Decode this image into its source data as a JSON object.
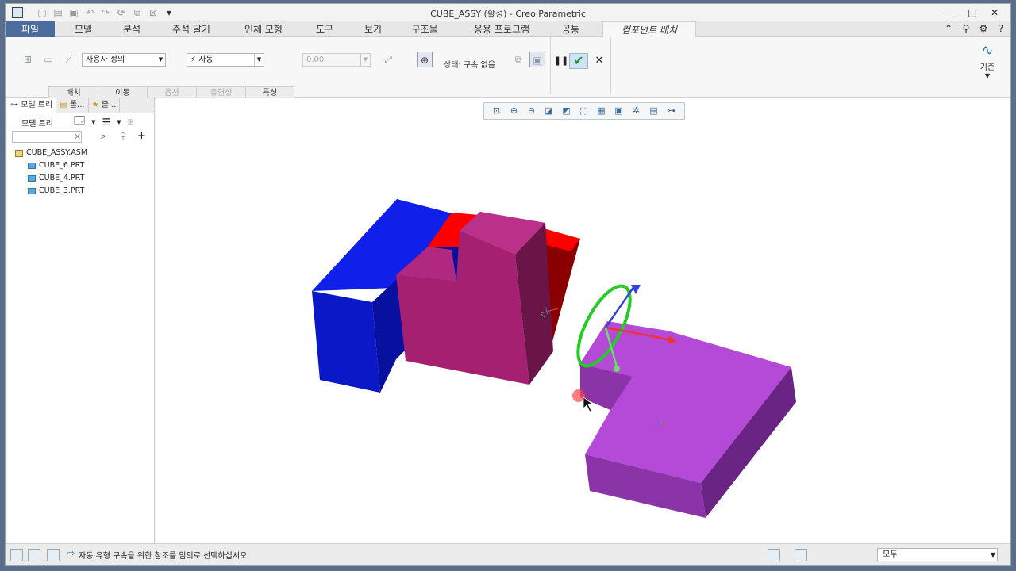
{
  "window": {
    "title": "CUBE_ASSY (활성) - Creo Parametric",
    "controls": [
      "—",
      "□",
      "✕"
    ]
  },
  "ribbon_tabs": [
    {
      "label": "파일"
    },
    {
      "label": "모델"
    },
    {
      "label": "분석"
    },
    {
      "label": "주석 달기"
    },
    {
      "label": "인체 모형"
    },
    {
      "label": "도구"
    },
    {
      "label": "보기"
    },
    {
      "label": "구조물"
    },
    {
      "label": "응용 프로그램"
    },
    {
      "label": "공통"
    },
    {
      "label": "컴포넌트 배치"
    }
  ],
  "ribbon": {
    "constraint_set": "사용자 정의",
    "constraint_type": "자동",
    "offset_value": "0.00",
    "status": "상태: 구속 없음",
    "subtabs": [
      "배치",
      "이동",
      "옵션",
      "유연성",
      "특성"
    ],
    "datum_label": "기준"
  },
  "sidebar": {
    "tabs": [
      "모델 트리",
      "폴...",
      "즐..."
    ],
    "toolbar_label": "모델 트리",
    "search_placeholder": "",
    "tree": {
      "root": "CUBE_ASSY.ASM",
      "children": [
        "CUBE_6.PRT",
        "CUBE_4.PRT",
        "CUBE_3.PRT"
      ]
    }
  },
  "statusbar": {
    "message": "자동 유형 구속을 위한 참조를 임의로 선택하십시오.",
    "filter": "모두"
  },
  "colors": {
    "file_tab": "#4b6c9c",
    "cube_blue": "#1020e8",
    "cube_red": "#ff0000",
    "cube_magenta": "#a52070",
    "cube_purple": "#b54ad8"
  }
}
